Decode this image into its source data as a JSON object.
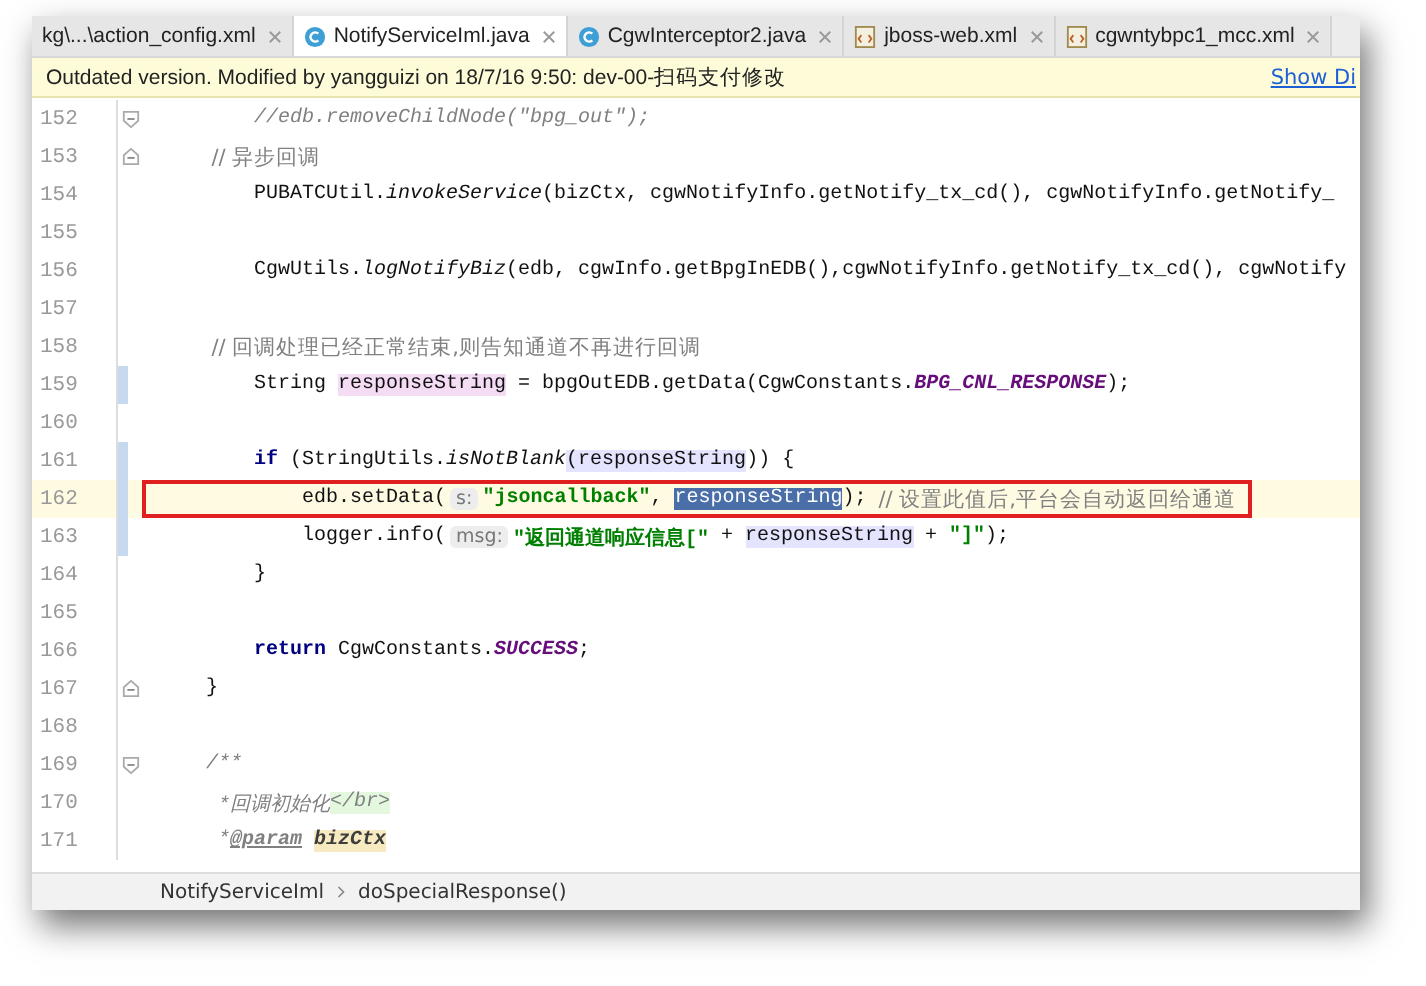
{
  "tabs": [
    {
      "label": "kg\\...\\action_config.xml",
      "kind": "none",
      "selected": false
    },
    {
      "label": "NotifyServiceIml.java",
      "kind": "java",
      "selected": true
    },
    {
      "label": "CgwInterceptor2.java",
      "kind": "java",
      "selected": false
    },
    {
      "label": "jboss-web.xml",
      "kind": "xml",
      "selected": false
    },
    {
      "label": "cgwntybpc1_mcc.xml",
      "kind": "xml",
      "selected": false
    }
  ],
  "banner": {
    "message": "Outdated version. Modified by yangguizi on 18/7/16 9:50: dev-00-扫码支付修改",
    "link": "Show Di"
  },
  "lines": [
    {
      "number": "152",
      "fold_start": true,
      "fold_end": false,
      "changed": false,
      "current": false,
      "boxed": false,
      "tokens": [
        {
          "kind": "comment",
          "text": "        //edb.removeChildNode(\"bpg_out\");"
        }
      ]
    },
    {
      "number": "153",
      "fold_start": false,
      "fold_end": true,
      "changed": false,
      "current": false,
      "boxed": false,
      "tokens": [
        {
          "kind": "comment-plain",
          "text": "        // 异步回调"
        }
      ]
    },
    {
      "number": "154",
      "fold_start": false,
      "fold_end": false,
      "changed": false,
      "current": false,
      "boxed": false,
      "tokens": [
        {
          "kind": "plain",
          "text": "        PUBATCUtil."
        },
        {
          "kind": "method",
          "text": "invokeService"
        },
        {
          "kind": "plain",
          "text": "(bizCtx, cgwNotifyInfo.getNotify_tx_cd(), cgwNotifyInfo.getNotify_"
        }
      ]
    },
    {
      "number": "155",
      "fold_start": false,
      "fold_end": false,
      "changed": false,
      "current": false,
      "boxed": false
    },
    {
      "number": "156",
      "fold_start": false,
      "fold_end": false,
      "changed": false,
      "current": false,
      "boxed": false,
      "tokens": [
        {
          "kind": "plain",
          "text": "        CgwUtils."
        },
        {
          "kind": "method",
          "text": "logNotifyBiz"
        },
        {
          "kind": "plain",
          "text": "(edb, cgwInfo.getBpgInEDB(),cgwNotifyInfo.getNotify_tx_cd(), cgwNotify"
        }
      ]
    },
    {
      "number": "157",
      "fold_start": false,
      "fold_end": false,
      "changed": false,
      "current": false,
      "boxed": false
    },
    {
      "number": "158",
      "fold_start": false,
      "fold_end": false,
      "changed": false,
      "current": false,
      "boxed": false,
      "tokens": [
        {
          "kind": "comment-plain",
          "text": "        // 回调处理已经正常结束,则告知通道不再进行回调"
        }
      ]
    },
    {
      "number": "159",
      "fold_start": false,
      "fold_end": false,
      "changed": true,
      "current": false,
      "boxed": false,
      "tokens": [
        {
          "kind": "plain",
          "text": "        String "
        },
        {
          "kind": "var-def",
          "text": "responseString"
        },
        {
          "kind": "plain",
          "text": " = bpgOutEDB.getData(CgwConstants."
        },
        {
          "kind": "constant",
          "text": "BPG_CNL_RESPONSE"
        },
        {
          "kind": "plain",
          "text": ");"
        }
      ]
    },
    {
      "number": "160",
      "fold_start": false,
      "fold_end": false,
      "changed": false,
      "current": false,
      "boxed": false
    },
    {
      "number": "161",
      "fold_start": false,
      "fold_end": false,
      "changed": true,
      "current": false,
      "boxed": false,
      "tokens": [
        {
          "kind": "keyword",
          "text": "        if"
        },
        {
          "kind": "plain",
          "text": " (StringUtils."
        },
        {
          "kind": "method",
          "text": "isNotBlank"
        },
        {
          "kind": "var-use",
          "text": "(responseString"
        },
        {
          "kind": "plain",
          "text": ")) {"
        }
      ]
    },
    {
      "number": "162",
      "fold_start": false,
      "fold_end": false,
      "changed": true,
      "current": true,
      "boxed": true,
      "tokens": [
        {
          "kind": "plain",
          "text": "            edb.setData("
        },
        {
          "kind": "hint",
          "text": "s:"
        },
        {
          "kind": "string",
          "text": "\"jsoncallback\""
        },
        {
          "kind": "plain",
          "text": ", "
        },
        {
          "kind": "var-selected",
          "text": "responseString"
        },
        {
          "kind": "plain",
          "text": "); "
        },
        {
          "kind": "comment-plain",
          "text": "// 设置此值后,平台会自动返回给通道"
        }
      ]
    },
    {
      "number": "163",
      "fold_start": false,
      "fold_end": false,
      "changed": true,
      "current": false,
      "boxed": false,
      "tokens": [
        {
          "kind": "plain",
          "text": "            logger.info("
        },
        {
          "kind": "hint",
          "text": "msg:"
        },
        {
          "kind": "string",
          "text": "\"返回通道响应信息[\""
        },
        {
          "kind": "plain",
          "text": " + "
        },
        {
          "kind": "var-use",
          "text": "responseString"
        },
        {
          "kind": "plain",
          "text": " + "
        },
        {
          "kind": "string",
          "text": "\"]\""
        },
        {
          "kind": "plain",
          "text": ");"
        }
      ]
    },
    {
      "number": "164",
      "fold_start": false,
      "fold_end": false,
      "changed": false,
      "current": false,
      "boxed": false,
      "tokens": [
        {
          "kind": "plain",
          "text": "        }"
        }
      ]
    },
    {
      "number": "165",
      "fold_start": false,
      "fold_end": false,
      "changed": false,
      "current": false,
      "boxed": false
    },
    {
      "number": "166",
      "fold_start": false,
      "fold_end": false,
      "changed": false,
      "current": false,
      "boxed": false,
      "tokens": [
        {
          "kind": "keyword",
          "text": "        return"
        },
        {
          "kind": "plain",
          "text": " CgwConstants."
        },
        {
          "kind": "constant",
          "text": "SUCCESS"
        },
        {
          "kind": "plain",
          "text": ";"
        }
      ]
    },
    {
      "number": "167",
      "fold_start": false,
      "fold_end": true,
      "changed": false,
      "current": false,
      "boxed": false,
      "tokens": [
        {
          "kind": "plain",
          "text": "    }"
        }
      ]
    },
    {
      "number": "168",
      "fold_start": false,
      "fold_end": false,
      "changed": false,
      "current": false,
      "boxed": false
    },
    {
      "number": "169",
      "fold_start": true,
      "fold_end": false,
      "changed": false,
      "current": false,
      "boxed": false,
      "tokens": [
        {
          "kind": "comment",
          "text": "    /**"
        }
      ]
    },
    {
      "number": "170",
      "fold_start": false,
      "fold_end": false,
      "changed": false,
      "current": false,
      "boxed": false,
      "tokens": [
        {
          "kind": "comment",
          "text": "     *回调初始化"
        },
        {
          "kind": "doc-html",
          "text": "</br>"
        }
      ]
    },
    {
      "number": "171",
      "fold_start": false,
      "fold_end": false,
      "changed": false,
      "current": false,
      "boxed": false,
      "tokens": [
        {
          "kind": "comment",
          "text": "     *"
        },
        {
          "kind": "doc-tag",
          "text": "@param"
        },
        {
          "kind": "doc-param",
          "text": "bizCtx"
        }
      ]
    }
  ],
  "breadcrumbs": [
    "NotifyServiceIml",
    "doSpecialResponse()"
  ]
}
